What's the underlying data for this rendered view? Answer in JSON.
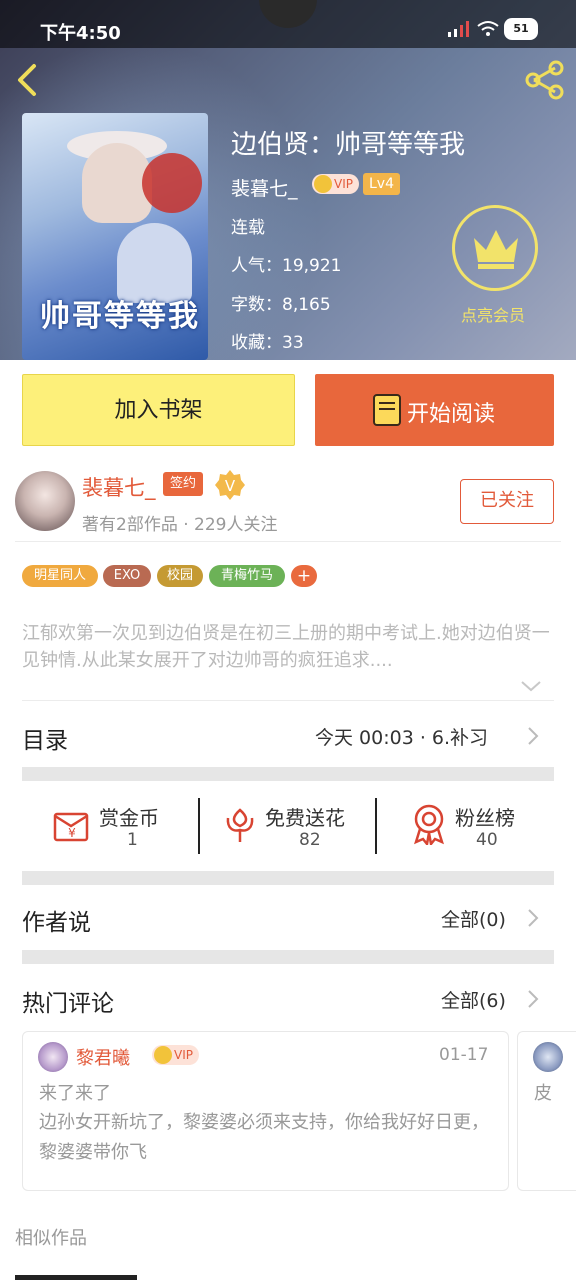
{
  "status_bar": {
    "time": "下午4:50",
    "battery": "51"
  },
  "book": {
    "title": "边伯贤：帅哥等等我",
    "author": "裴暮七_",
    "vip": "VIP",
    "level": "Lv4",
    "status": "连载",
    "popularity": "人气：19,921",
    "word_count": "字数：8,165",
    "favorites": "收藏：33",
    "cover_title": "帅哥等等我"
  },
  "member_label": "点亮会员",
  "buttons": {
    "add_shelf": "加入书架",
    "start_reading": "开始阅读"
  },
  "author_card": {
    "name": "裴暮七_",
    "signed": "签约",
    "meta": "著有2部作品 · 229人关注",
    "follow": "已关注"
  },
  "tags": [
    {
      "label": "明星同人",
      "color": "#f0a93e"
    },
    {
      "label": "EXO",
      "color": "#b96a52"
    },
    {
      "label": "校园",
      "color": "#c59a33"
    },
    {
      "label": "青梅竹马",
      "color": "#6cb257"
    },
    {
      "label": "+",
      "color": "#e96a3e"
    }
  ],
  "summary": "江郁欢第一次见到边伯贤是在初三上册的期中考试上.她对边伯贤一见钟情.从此某女展开了对边帅哥的疯狂追求....",
  "catalog": {
    "label": "目录",
    "latest": "今天 00:03 · 6.补习"
  },
  "stats": [
    {
      "label": "赏金币",
      "value": "1",
      "icon": "reward-envelope-icon"
    },
    {
      "label": "免费送花",
      "value": "82",
      "icon": "flower-icon"
    },
    {
      "label": "粉丝榜",
      "value": "40",
      "icon": "medal-icon"
    }
  ],
  "author_says": {
    "label": "作者说",
    "all": "全部(0)"
  },
  "hot_comments": {
    "label": "热门评论",
    "all": "全部(6)"
  },
  "comment": {
    "user": "黎君曦",
    "vip": "VIP",
    "date": "01-17",
    "title": "来了来了",
    "body": "边孙女开新坑了，黎婆婆必须来支持，你给我好好日更，黎婆婆带你飞"
  },
  "comment_peek": "皮",
  "similar": "相似作品",
  "colors": {
    "accent_orange": "#e8673c",
    "yellow_button": "#fdf07a",
    "crown": "#f2e36a"
  }
}
